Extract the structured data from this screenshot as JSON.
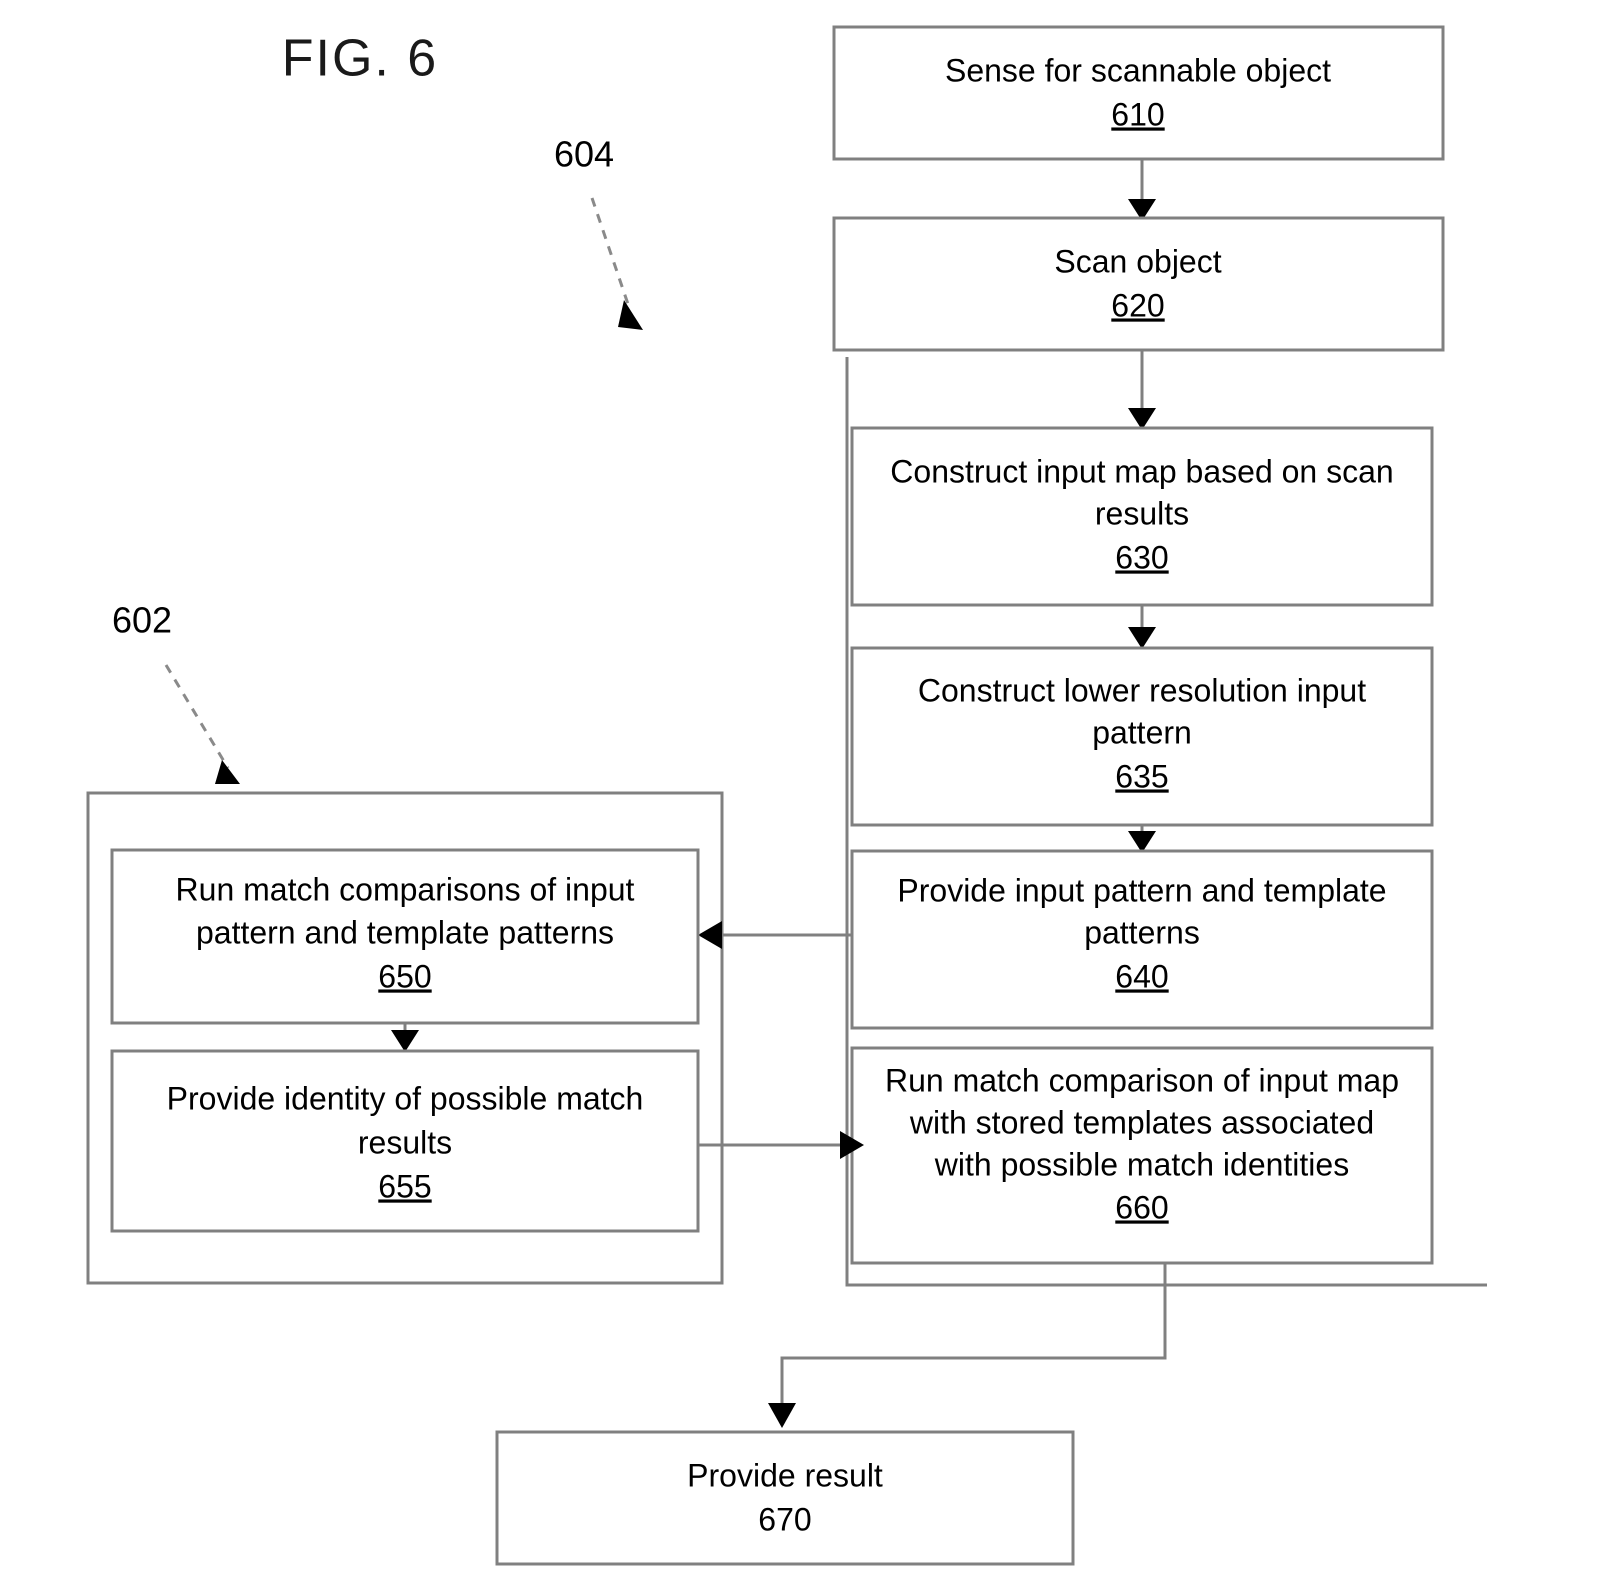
{
  "figure": {
    "title": "FIG. 6",
    "callouts": [
      {
        "id": "callout-604",
        "label": "604"
      },
      {
        "id": "callout-602",
        "label": "602"
      }
    ]
  },
  "nodes": {
    "n610": {
      "lines": [
        "Sense for scannable object"
      ],
      "ref": "610",
      "ref_underlined": true
    },
    "n620": {
      "lines": [
        "Scan object"
      ],
      "ref": "620",
      "ref_underlined": true
    },
    "n630": {
      "lines": [
        "Construct input map based on scan",
        "results"
      ],
      "ref": "630",
      "ref_underlined": true
    },
    "n635": {
      "lines": [
        "Construct lower resolution input",
        "pattern"
      ],
      "ref": "635",
      "ref_underlined": true
    },
    "n640": {
      "lines": [
        "Provide input pattern and template",
        "patterns"
      ],
      "ref": "640",
      "ref_underlined": true
    },
    "n660": {
      "lines": [
        "Run match comparison of input map",
        "with stored templates associated",
        "with possible match identities"
      ],
      "ref": "660",
      "ref_underlined": true
    },
    "n650": {
      "lines": [
        "Run match comparisons of input",
        "pattern and template patterns"
      ],
      "ref": "650",
      "ref_underlined": true
    },
    "n655": {
      "lines": [
        "Provide identity of possible match",
        "results"
      ],
      "ref": "655",
      "ref_underlined": true
    },
    "n670": {
      "lines": [
        "Provide result"
      ],
      "ref": "670",
      "ref_underlined": false
    }
  },
  "colors": {
    "box_stroke": "#808080",
    "connector": "#808080",
    "arrowhead": "#000000",
    "text": "#000000",
    "background": "#ffffff"
  }
}
